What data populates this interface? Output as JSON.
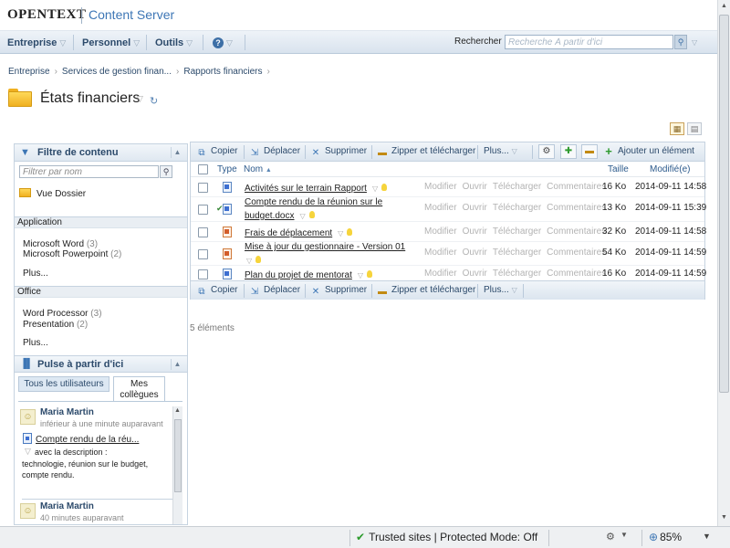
{
  "header": {
    "brand": "OPENTEXT",
    "product": "Content Server"
  },
  "nav": {
    "items": [
      "Entreprise",
      "Personnel",
      "Outils"
    ],
    "help_glyph": "?",
    "search_label": "Rechercher",
    "search_placeholder": "Recherche À partir d'ici"
  },
  "breadcrumb": [
    "Entreprise",
    "Services de gestion finan...",
    "Rapports financiers"
  ],
  "page": {
    "title": "États financiers"
  },
  "content_filter": {
    "title": "Filtre de contenu",
    "filter_placeholder": "Filtrer par nom",
    "folder_view": "Vue Dossier",
    "sections": [
      {
        "name": "Application",
        "items": [
          {
            "label": "Microsoft Word",
            "count": "(3)"
          },
          {
            "label": "Microsoft Powerpoint",
            "count": "(2)"
          }
        ],
        "more": "Plus..."
      },
      {
        "name": "Office",
        "items": [
          {
            "label": "Word Processor",
            "count": "(3)"
          },
          {
            "label": "Presentation",
            "count": "(2)"
          }
        ],
        "more": "Plus..."
      }
    ]
  },
  "pulse": {
    "title": "Pulse à partir d'ici",
    "tabs": [
      "Tous les utilisateurs",
      "Mes collègues"
    ],
    "entries": [
      {
        "user": "Maria Martin",
        "time": "inférieur à une minute auparavant",
        "doc": "Compte rendu de la réu...",
        "desc_intro": "avec la description :",
        "desc": "technologie, réunion sur le budget, compte rendu."
      },
      {
        "user": "Maria Martin",
        "time": "40 minutes auparavant"
      }
    ]
  },
  "toolbar": {
    "copy": "Copier",
    "move": "Déplacer",
    "delete": "Supprimer",
    "zip": "Zipper et télécharger",
    "more": "Plus...",
    "add_item": "Ajouter un élément"
  },
  "table": {
    "columns": {
      "type": "Type",
      "name": "Nom",
      "size": "Taille",
      "modified": "Modifié(e)"
    },
    "actions": [
      "Modifier",
      "Ouvrir",
      "Télécharger",
      "Commentaires"
    ],
    "rows": [
      {
        "name": "Activités sur le terrain Rapport",
        "name2": "",
        "type": "word",
        "size": "16 Ko",
        "modified": "2014-09-11 14:58"
      },
      {
        "name": "Compte rendu de la réunion sur le",
        "name2": "budget.docx",
        "type": "word",
        "size": "13 Ko",
        "modified": "2014-09-11 15:39"
      },
      {
        "name": "Frais de déplacement",
        "name2": "",
        "type": "powerpoint",
        "size": "32 Ko",
        "modified": "2014-09-11 14:58"
      },
      {
        "name": "Mise à jour du gestionnaire - Version 01",
        "name2": "",
        "type": "powerpoint",
        "size": "54 Ko",
        "modified": "2014-09-11 14:59"
      },
      {
        "name": "Plan du projet de mentorat",
        "name2": "",
        "type": "word",
        "size": "16 Ko",
        "modified": "2014-09-11 14:59"
      }
    ],
    "count": "5 éléments"
  },
  "statusbar": {
    "trust": "Trusted sites | Protected Mode: Off",
    "zoom": "85%"
  },
  "colors": {
    "accent": "#3d76b5",
    "nav_text": "#2c4a6b",
    "folder": "#f0b020",
    "add_green": "#2d9a2d"
  }
}
